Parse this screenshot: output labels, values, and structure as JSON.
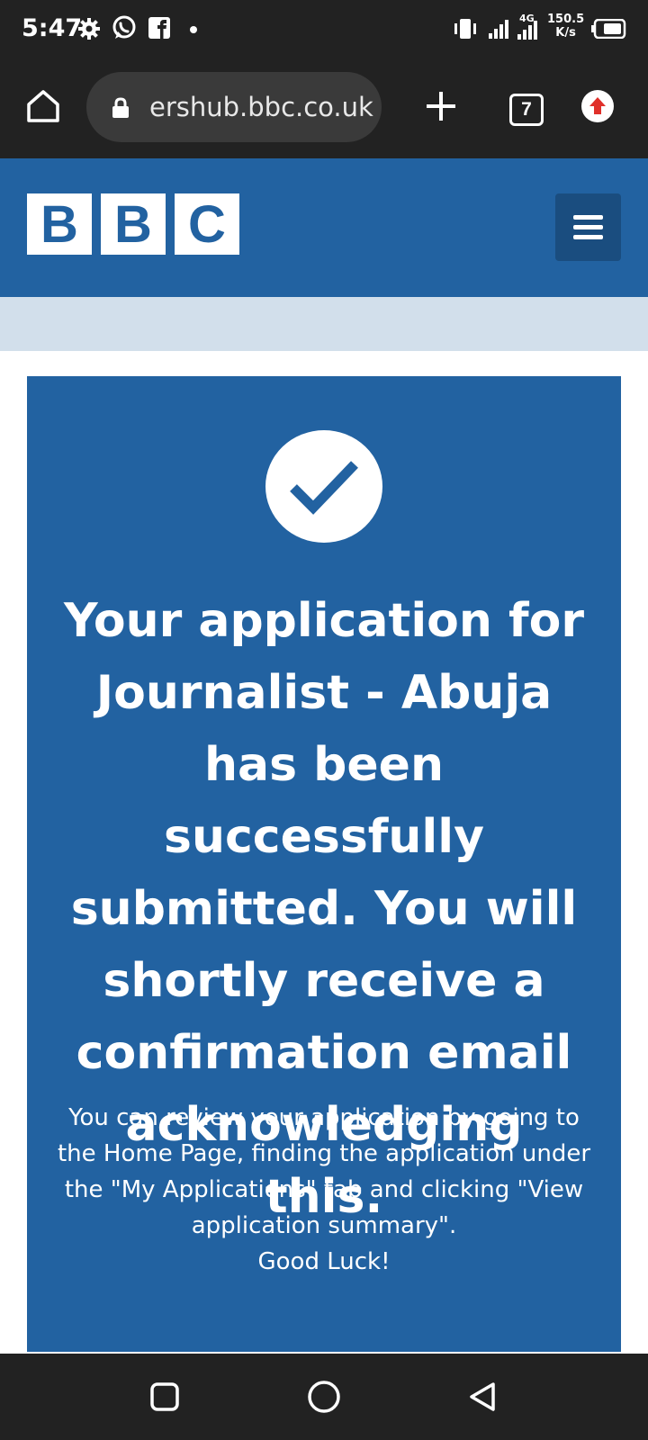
{
  "status_bar": {
    "time": "5:47",
    "speed_value": "150.5",
    "speed_unit": "K/s",
    "network": "4G",
    "icons": [
      "gear-icon",
      "whatsapp-icon",
      "facebook-icon",
      "dot-icon",
      "vibrate-icon",
      "signal-icon",
      "signal-4g-icon",
      "battery-icon"
    ]
  },
  "browser": {
    "url": "ershub.bbc.co.uk",
    "tab_count": "7",
    "icons": [
      "home-icon",
      "lock-icon",
      "plus-icon",
      "update-icon"
    ]
  },
  "header": {
    "logo_letters": [
      "B",
      "B",
      "C"
    ],
    "menu_icon": "hamburger-icon",
    "brand_color": "#2262a1"
  },
  "confirmation": {
    "icon": "checkmark-icon",
    "heading": "Your application for Journalist - Abuja has been successfully submitted. You will shortly receive a confirmation email acknowledging this.",
    "body": "You can review your application by going to the Home Page, finding the application under the \"My Applications\" tab and clicking \"View application summary\".",
    "sign_off": "Good Luck!"
  },
  "nav_bar": {
    "icons": [
      "recents-square-icon",
      "home-circle-icon",
      "back-triangle-icon"
    ]
  }
}
